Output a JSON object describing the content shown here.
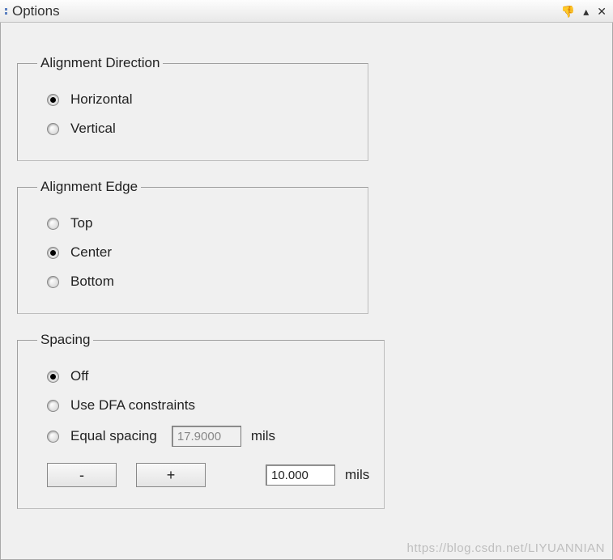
{
  "titlebar": {
    "title": "Options"
  },
  "groups": {
    "alignment_direction": {
      "legend": "Alignment Direction",
      "options": {
        "horizontal": "Horizontal",
        "vertical": "Vertical"
      },
      "selected": "horizontal"
    },
    "alignment_edge": {
      "legend": "Alignment Edge",
      "options": {
        "top": "Top",
        "center": "Center",
        "bottom": "Bottom"
      },
      "selected": "center"
    },
    "spacing": {
      "legend": "Spacing",
      "options": {
        "off": "Off",
        "dfa": "Use DFA constraints",
        "equal": "Equal spacing"
      },
      "selected": "off",
      "equal_value": "17.9000",
      "equal_unit": "mils",
      "step_minus": "-",
      "step_plus": "+",
      "step_value": "10.000",
      "step_unit": "mils"
    }
  },
  "watermark": "https://blog.csdn.net/LIYUANNIAN"
}
